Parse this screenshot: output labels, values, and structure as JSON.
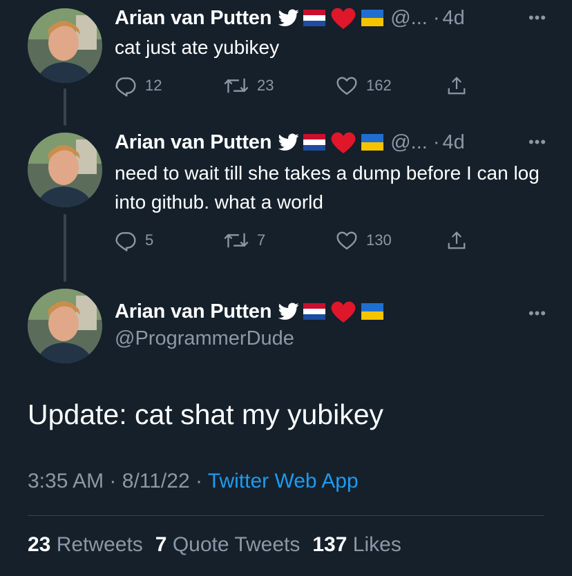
{
  "author": {
    "name": "Arian van Putten",
    "handle_truncated": "@...",
    "handle": "@ProgrammerDude"
  },
  "thread": [
    {
      "time": "4d",
      "text": "cat just ate yubikey",
      "replies": "12",
      "retweets": "23",
      "likes": "162"
    },
    {
      "time": "4d",
      "text": "need to wait till she takes a dump before I can log into github. what a world",
      "replies": "5",
      "retweets": "7",
      "likes": "130"
    }
  ],
  "main_tweet": {
    "text": "Update: cat shat my yubikey",
    "time": "3:35 AM",
    "date": "8/11/22",
    "source": "Twitter Web App",
    "separator": "·",
    "retweets": "23",
    "retweets_label": "Retweets",
    "quote_tweets": "7",
    "quote_tweets_label": "Quote Tweets",
    "likes": "137",
    "likes_label": "Likes"
  },
  "colors": {
    "background": "#15202b",
    "secondary_text": "#8b98a5",
    "link": "#1d9bf0",
    "divider": "#38444d"
  },
  "icons": [
    "verified-bird-icon",
    "flag-netherlands-icon",
    "red-heart-emoji-icon",
    "flag-ukraine-icon",
    "more-icon",
    "reply-icon",
    "retweet-icon",
    "like-icon",
    "share-icon"
  ]
}
